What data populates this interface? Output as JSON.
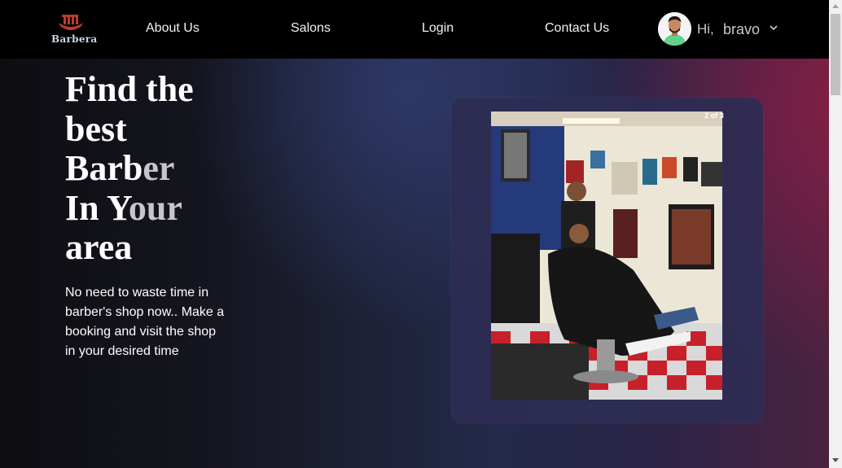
{
  "brand": {
    "name": "Barbera"
  },
  "nav": {
    "links": [
      "About Us",
      "Salons",
      "Login",
      "Contact Us"
    ]
  },
  "user": {
    "greeting": "Hi,",
    "name": "bravo"
  },
  "hero": {
    "headline": {
      "line1": "Find the",
      "line2": "best",
      "line3_main": "Barb",
      "line3_fade": "er",
      "line4_main": "In Y",
      "line4_fade": "our",
      "line5": "area"
    },
    "subtext": "No need to waste time in barber's shop now.. Make a booking and visit the shop in your desired time"
  },
  "carousel": {
    "counter": "2 of 3"
  },
  "colors": {
    "navbar": "#000000",
    "card": "#2e2c54",
    "accent_red": "#c0392b"
  }
}
